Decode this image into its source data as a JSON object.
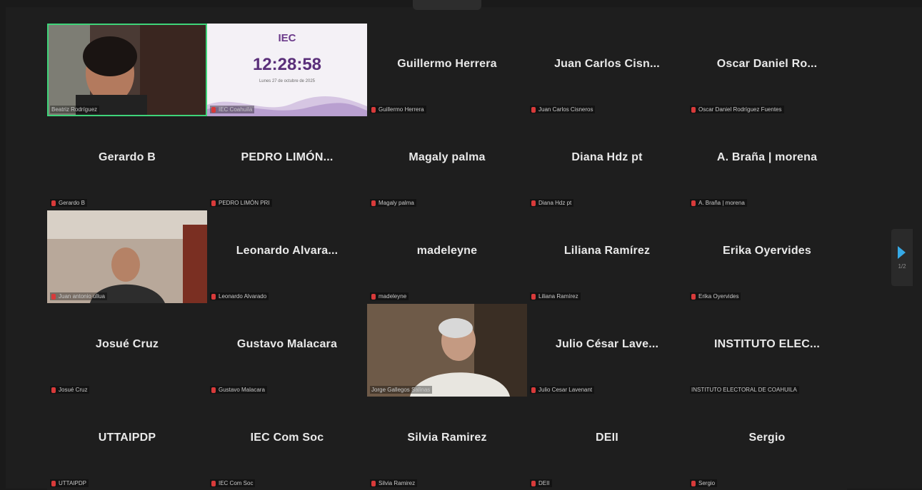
{
  "clock": {
    "logo": "IEC",
    "time": "12:28:58",
    "date": "Lunes 27 de octubre de 2025",
    "label": "IEC Coahuila"
  },
  "tiles": [
    {
      "name": "",
      "label": "Beatriz Rodríguez"
    },
    {
      "name": "Guillermo Herrera",
      "label": "Guillermo Herrera"
    },
    {
      "name": "Juan Carlos Cisn...",
      "label": "Juan Carlos Cisneros"
    },
    {
      "name": "Oscar Daniel Ro...",
      "label": "Oscar Daniel Rodríguez Fuentes"
    },
    {
      "name": "Gerardo B",
      "label": "Gerardo B"
    },
    {
      "name": "PEDRO LIMÓN...",
      "label": "PEDRO LIMÓN PRI"
    },
    {
      "name": "Magaly palma",
      "label": "Magaly palma"
    },
    {
      "name": "Diana Hdz pt",
      "label": "Diana Hdz pt"
    },
    {
      "name": "A. Braña | morena",
      "label": "A. Braña | morena"
    },
    {
      "name": "",
      "label": "Juan antonio ullua"
    },
    {
      "name": "Leonardo Alvara...",
      "label": "Leonardo Alvarado"
    },
    {
      "name": "madeleyne",
      "label": "madeleyne"
    },
    {
      "name": "Liliana Ramírez",
      "label": "Liliana Ramírez"
    },
    {
      "name": "Erika Oyervides",
      "label": "Erika Oyervides"
    },
    {
      "name": "Josué Cruz",
      "label": "Josué Cruz"
    },
    {
      "name": "Gustavo Malacara",
      "label": "Gustavo Malacara"
    },
    {
      "name": "",
      "label": "Jorge Gallegos Salinas"
    },
    {
      "name": "Julio César Lave...",
      "label": "Julio Cesar Lavenant"
    },
    {
      "name": "INSTITUTO ELEC...",
      "label": "INSTITUTO ELECTORAL DE COAHUILA"
    },
    {
      "name": "UTTAIPDP",
      "label": "UTTAIPDP"
    },
    {
      "name": "IEC Com Soc",
      "label": "IEC Com Soc"
    },
    {
      "name": "Silvia Ramirez",
      "label": "Silvia Ramirez"
    },
    {
      "name": "DEII",
      "label": "DEII"
    },
    {
      "name": "Sergio",
      "label": "Sergio"
    }
  ],
  "pager": {
    "label": "1/2",
    "icon": "chevron-right-icon"
  },
  "colors": {
    "active_speaker": "#3fd47a",
    "mic_muted": "#d83a3a",
    "next_arrow": "#36a9e6"
  }
}
